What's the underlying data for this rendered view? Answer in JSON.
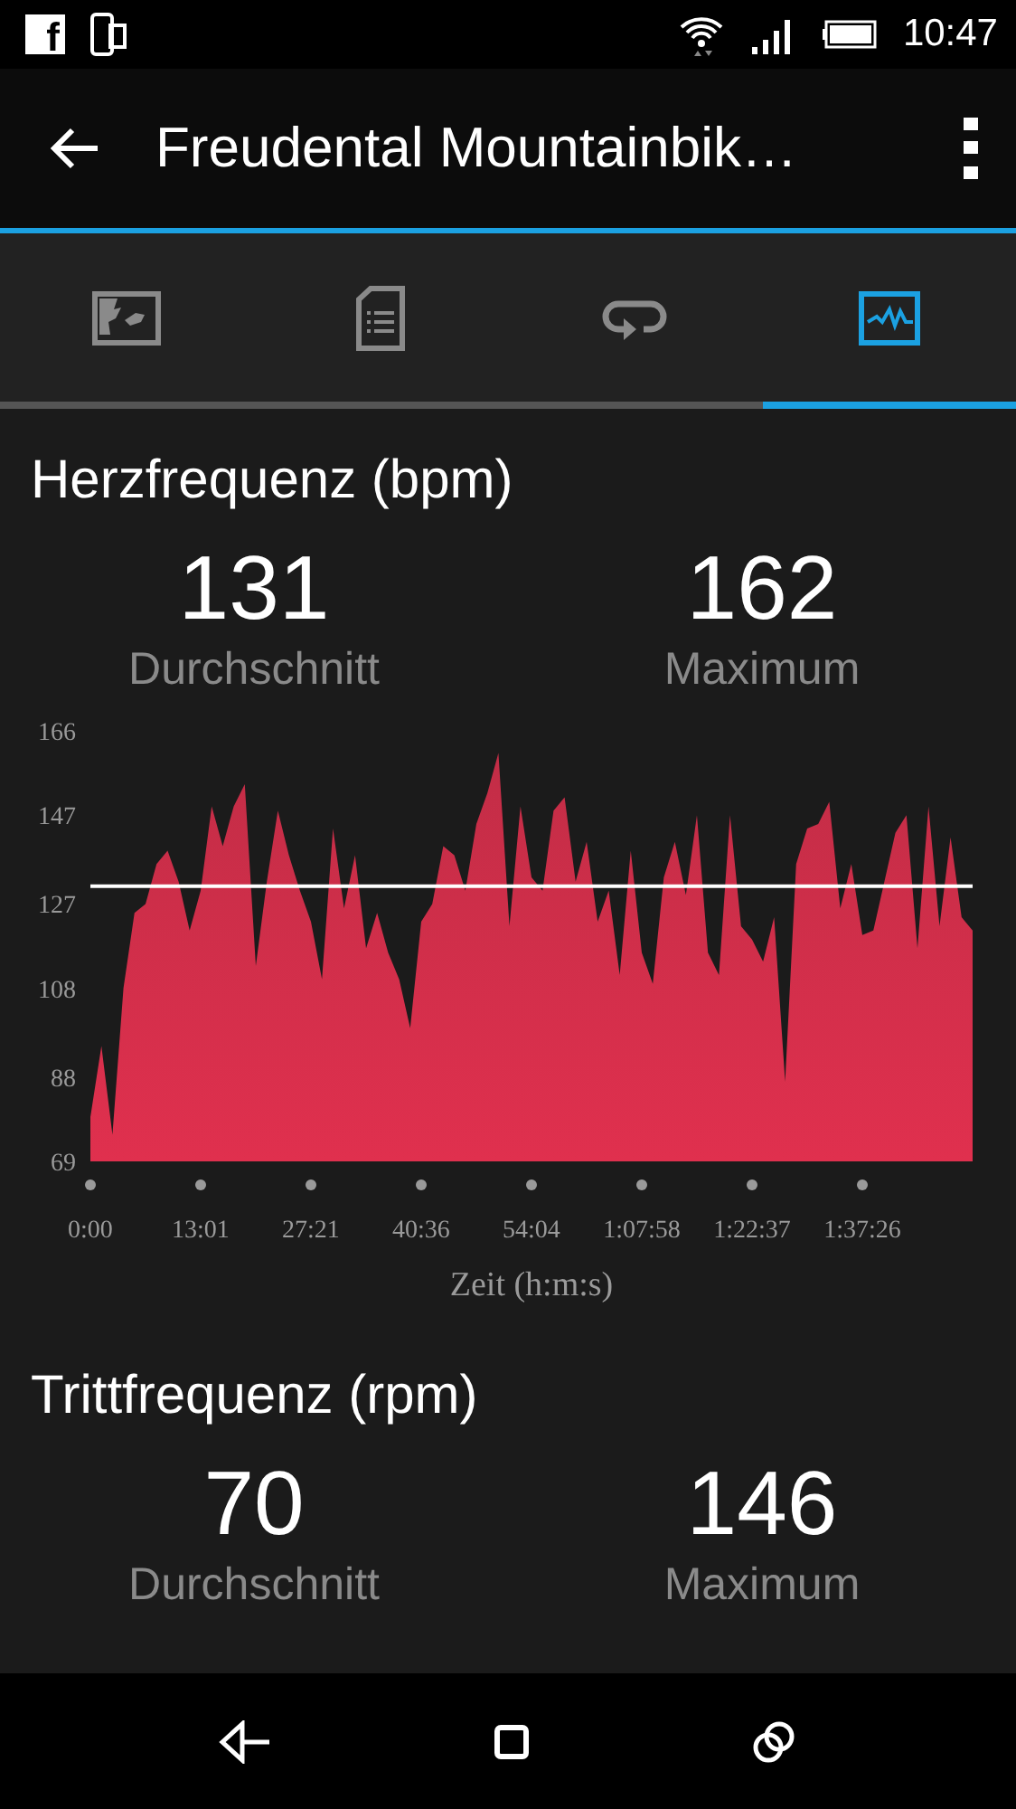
{
  "status_bar": {
    "notification_icons": [
      {
        "kind": "facebook",
        "label": "f"
      },
      {
        "kind": "devices"
      }
    ],
    "time": "10:47"
  },
  "app_bar": {
    "title": "Freudental Mountainbik…"
  },
  "tabs": [
    {
      "kind": "map",
      "selected": false
    },
    {
      "kind": "details",
      "selected": false
    },
    {
      "kind": "laps",
      "selected": false
    },
    {
      "kind": "charts",
      "selected": true
    }
  ],
  "sections": [
    {
      "title": "Herzfrequenz (bpm)",
      "stats": [
        {
          "value": "131",
          "label": "Durchschnitt"
        },
        {
          "value": "162",
          "label": "Maximum"
        }
      ],
      "chart_data": {
        "type": "area",
        "xlabel": "Zeit (h:m:s)",
        "categories": [
          "0:00",
          null,
          null,
          null,
          null,
          null,
          null,
          null,
          null,
          null,
          "13:01",
          null,
          null,
          null,
          null,
          null,
          null,
          null,
          null,
          null,
          "27:21",
          null,
          null,
          null,
          null,
          null,
          null,
          null,
          null,
          null,
          "40:36",
          null,
          null,
          null,
          null,
          null,
          null,
          null,
          null,
          null,
          "54:04",
          null,
          null,
          null,
          null,
          null,
          null,
          null,
          null,
          null,
          "1:07:58",
          null,
          null,
          null,
          null,
          null,
          null,
          null,
          null,
          null,
          "1:22:37",
          null,
          null,
          null,
          null,
          null,
          null,
          null,
          null,
          null,
          "1:37:26",
          null,
          null,
          null,
          null,
          null,
          null,
          null,
          null,
          null,
          null
        ],
        "series": [
          {
            "color": "#e0304e",
            "values": [
              79,
              95,
              75,
              108,
              125,
              127,
              136,
              139,
              132,
              121,
              130,
              149,
              140,
              149,
              154,
              113,
              132,
              148,
              138,
              130,
              123,
              110,
              144,
              126,
              138,
              117,
              125,
              116,
              110,
              99,
              123,
              127,
              140,
              138,
              130,
              145,
              152,
              161,
              122,
              149,
              133,
              130,
              148,
              151,
              132,
              141,
              123,
              130,
              111,
              139,
              116,
              109,
              133,
              141,
              129,
              147,
              116,
              111,
              147,
              122,
              119,
              114,
              124,
              87,
              136,
              144,
              145,
              150,
              126,
              136,
              120,
              121,
              132,
              143,
              147,
              117,
              149,
              122,
              142,
              124,
              121
            ]
          }
        ],
        "ylim": [
          69,
          166
        ],
        "yticks": [
          69,
          88,
          108,
          127,
          147,
          166
        ],
        "ref_lines": [
          {
            "axis": "y",
            "value": 131
          }
        ]
      }
    },
    {
      "title": "Trittfrequenz (rpm)",
      "stats": [
        {
          "value": "70",
          "label": "Durchschnitt"
        },
        {
          "value": "146",
          "label": "Maximum"
        }
      ]
    }
  ]
}
